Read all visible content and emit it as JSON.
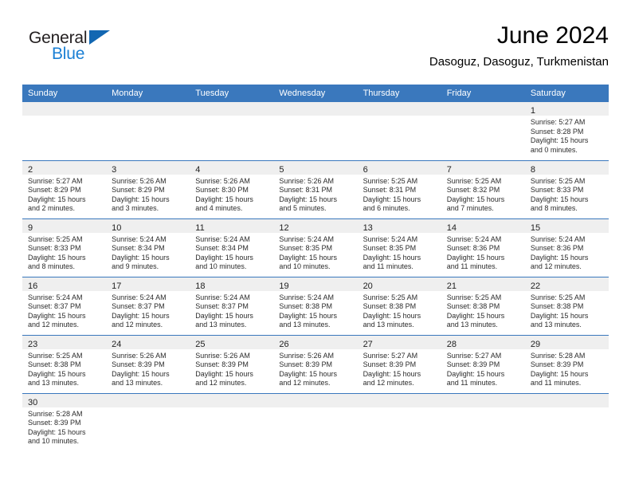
{
  "brand": {
    "word_one": "General",
    "word_two": "Blue",
    "triangle_color": "#1267b2",
    "blue_text_color": "#1a7fd4",
    "dark_text_color": "#231f20"
  },
  "header": {
    "month_title": "June 2024",
    "location": "Dasoguz, Dasoguz, Turkmenistan"
  },
  "theme": {
    "header_row_bg": "#3a78bd",
    "day_band_bg": "#efefef",
    "row_divider": "#3a78bd",
    "text": "#2b2b2b"
  },
  "weekday_headers": [
    "Sunday",
    "Monday",
    "Tuesday",
    "Wednesday",
    "Thursday",
    "Friday",
    "Saturday"
  ],
  "weeks": [
    [
      {
        "day": "",
        "sunrise": "",
        "sunset": "",
        "daylight_line1": "",
        "daylight_line2": "",
        "empty": true
      },
      {
        "day": "",
        "sunrise": "",
        "sunset": "",
        "daylight_line1": "",
        "daylight_line2": "",
        "empty": true
      },
      {
        "day": "",
        "sunrise": "",
        "sunset": "",
        "daylight_line1": "",
        "daylight_line2": "",
        "empty": true
      },
      {
        "day": "",
        "sunrise": "",
        "sunset": "",
        "daylight_line1": "",
        "daylight_line2": "",
        "empty": true
      },
      {
        "day": "",
        "sunrise": "",
        "sunset": "",
        "daylight_line1": "",
        "daylight_line2": "",
        "empty": true
      },
      {
        "day": "",
        "sunrise": "",
        "sunset": "",
        "daylight_line1": "",
        "daylight_line2": "",
        "empty": true
      },
      {
        "day": "1",
        "sunrise": "Sunrise: 5:27 AM",
        "sunset": "Sunset: 8:28 PM",
        "daylight_line1": "Daylight: 15 hours",
        "daylight_line2": "and 0 minutes.",
        "empty": false
      }
    ],
    [
      {
        "day": "2",
        "sunrise": "Sunrise: 5:27 AM",
        "sunset": "Sunset: 8:29 PM",
        "daylight_line1": "Daylight: 15 hours",
        "daylight_line2": "and 2 minutes.",
        "empty": false
      },
      {
        "day": "3",
        "sunrise": "Sunrise: 5:26 AM",
        "sunset": "Sunset: 8:29 PM",
        "daylight_line1": "Daylight: 15 hours",
        "daylight_line2": "and 3 minutes.",
        "empty": false
      },
      {
        "day": "4",
        "sunrise": "Sunrise: 5:26 AM",
        "sunset": "Sunset: 8:30 PM",
        "daylight_line1": "Daylight: 15 hours",
        "daylight_line2": "and 4 minutes.",
        "empty": false
      },
      {
        "day": "5",
        "sunrise": "Sunrise: 5:26 AM",
        "sunset": "Sunset: 8:31 PM",
        "daylight_line1": "Daylight: 15 hours",
        "daylight_line2": "and 5 minutes.",
        "empty": false
      },
      {
        "day": "6",
        "sunrise": "Sunrise: 5:25 AM",
        "sunset": "Sunset: 8:31 PM",
        "daylight_line1": "Daylight: 15 hours",
        "daylight_line2": "and 6 minutes.",
        "empty": false
      },
      {
        "day": "7",
        "sunrise": "Sunrise: 5:25 AM",
        "sunset": "Sunset: 8:32 PM",
        "daylight_line1": "Daylight: 15 hours",
        "daylight_line2": "and 7 minutes.",
        "empty": false
      },
      {
        "day": "8",
        "sunrise": "Sunrise: 5:25 AM",
        "sunset": "Sunset: 8:33 PM",
        "daylight_line1": "Daylight: 15 hours",
        "daylight_line2": "and 8 minutes.",
        "empty": false
      }
    ],
    [
      {
        "day": "9",
        "sunrise": "Sunrise: 5:25 AM",
        "sunset": "Sunset: 8:33 PM",
        "daylight_line1": "Daylight: 15 hours",
        "daylight_line2": "and 8 minutes.",
        "empty": false
      },
      {
        "day": "10",
        "sunrise": "Sunrise: 5:24 AM",
        "sunset": "Sunset: 8:34 PM",
        "daylight_line1": "Daylight: 15 hours",
        "daylight_line2": "and 9 minutes.",
        "empty": false
      },
      {
        "day": "11",
        "sunrise": "Sunrise: 5:24 AM",
        "sunset": "Sunset: 8:34 PM",
        "daylight_line1": "Daylight: 15 hours",
        "daylight_line2": "and 10 minutes.",
        "empty": false
      },
      {
        "day": "12",
        "sunrise": "Sunrise: 5:24 AM",
        "sunset": "Sunset: 8:35 PM",
        "daylight_line1": "Daylight: 15 hours",
        "daylight_line2": "and 10 minutes.",
        "empty": false
      },
      {
        "day": "13",
        "sunrise": "Sunrise: 5:24 AM",
        "sunset": "Sunset: 8:35 PM",
        "daylight_line1": "Daylight: 15 hours",
        "daylight_line2": "and 11 minutes.",
        "empty": false
      },
      {
        "day": "14",
        "sunrise": "Sunrise: 5:24 AM",
        "sunset": "Sunset: 8:36 PM",
        "daylight_line1": "Daylight: 15 hours",
        "daylight_line2": "and 11 minutes.",
        "empty": false
      },
      {
        "day": "15",
        "sunrise": "Sunrise: 5:24 AM",
        "sunset": "Sunset: 8:36 PM",
        "daylight_line1": "Daylight: 15 hours",
        "daylight_line2": "and 12 minutes.",
        "empty": false
      }
    ],
    [
      {
        "day": "16",
        "sunrise": "Sunrise: 5:24 AM",
        "sunset": "Sunset: 8:37 PM",
        "daylight_line1": "Daylight: 15 hours",
        "daylight_line2": "and 12 minutes.",
        "empty": false
      },
      {
        "day": "17",
        "sunrise": "Sunrise: 5:24 AM",
        "sunset": "Sunset: 8:37 PM",
        "daylight_line1": "Daylight: 15 hours",
        "daylight_line2": "and 12 minutes.",
        "empty": false
      },
      {
        "day": "18",
        "sunrise": "Sunrise: 5:24 AM",
        "sunset": "Sunset: 8:37 PM",
        "daylight_line1": "Daylight: 15 hours",
        "daylight_line2": "and 13 minutes.",
        "empty": false
      },
      {
        "day": "19",
        "sunrise": "Sunrise: 5:24 AM",
        "sunset": "Sunset: 8:38 PM",
        "daylight_line1": "Daylight: 15 hours",
        "daylight_line2": "and 13 minutes.",
        "empty": false
      },
      {
        "day": "20",
        "sunrise": "Sunrise: 5:25 AM",
        "sunset": "Sunset: 8:38 PM",
        "daylight_line1": "Daylight: 15 hours",
        "daylight_line2": "and 13 minutes.",
        "empty": false
      },
      {
        "day": "21",
        "sunrise": "Sunrise: 5:25 AM",
        "sunset": "Sunset: 8:38 PM",
        "daylight_line1": "Daylight: 15 hours",
        "daylight_line2": "and 13 minutes.",
        "empty": false
      },
      {
        "day": "22",
        "sunrise": "Sunrise: 5:25 AM",
        "sunset": "Sunset: 8:38 PM",
        "daylight_line1": "Daylight: 15 hours",
        "daylight_line2": "and 13 minutes.",
        "empty": false
      }
    ],
    [
      {
        "day": "23",
        "sunrise": "Sunrise: 5:25 AM",
        "sunset": "Sunset: 8:38 PM",
        "daylight_line1": "Daylight: 15 hours",
        "daylight_line2": "and 13 minutes.",
        "empty": false
      },
      {
        "day": "24",
        "sunrise": "Sunrise: 5:26 AM",
        "sunset": "Sunset: 8:39 PM",
        "daylight_line1": "Daylight: 15 hours",
        "daylight_line2": "and 13 minutes.",
        "empty": false
      },
      {
        "day": "25",
        "sunrise": "Sunrise: 5:26 AM",
        "sunset": "Sunset: 8:39 PM",
        "daylight_line1": "Daylight: 15 hours",
        "daylight_line2": "and 12 minutes.",
        "empty": false
      },
      {
        "day": "26",
        "sunrise": "Sunrise: 5:26 AM",
        "sunset": "Sunset: 8:39 PM",
        "daylight_line1": "Daylight: 15 hours",
        "daylight_line2": "and 12 minutes.",
        "empty": false
      },
      {
        "day": "27",
        "sunrise": "Sunrise: 5:27 AM",
        "sunset": "Sunset: 8:39 PM",
        "daylight_line1": "Daylight: 15 hours",
        "daylight_line2": "and 12 minutes.",
        "empty": false
      },
      {
        "day": "28",
        "sunrise": "Sunrise: 5:27 AM",
        "sunset": "Sunset: 8:39 PM",
        "daylight_line1": "Daylight: 15 hours",
        "daylight_line2": "and 11 minutes.",
        "empty": false
      },
      {
        "day": "29",
        "sunrise": "Sunrise: 5:28 AM",
        "sunset": "Sunset: 8:39 PM",
        "daylight_line1": "Daylight: 15 hours",
        "daylight_line2": "and 11 minutes.",
        "empty": false
      }
    ],
    [
      {
        "day": "30",
        "sunrise": "Sunrise: 5:28 AM",
        "sunset": "Sunset: 8:39 PM",
        "daylight_line1": "Daylight: 15 hours",
        "daylight_line2": "and 10 minutes.",
        "empty": false
      },
      {
        "day": "",
        "sunrise": "",
        "sunset": "",
        "daylight_line1": "",
        "daylight_line2": "",
        "empty": true
      },
      {
        "day": "",
        "sunrise": "",
        "sunset": "",
        "daylight_line1": "",
        "daylight_line2": "",
        "empty": true
      },
      {
        "day": "",
        "sunrise": "",
        "sunset": "",
        "daylight_line1": "",
        "daylight_line2": "",
        "empty": true
      },
      {
        "day": "",
        "sunrise": "",
        "sunset": "",
        "daylight_line1": "",
        "daylight_line2": "",
        "empty": true
      },
      {
        "day": "",
        "sunrise": "",
        "sunset": "",
        "daylight_line1": "",
        "daylight_line2": "",
        "empty": true
      },
      {
        "day": "",
        "sunrise": "",
        "sunset": "",
        "daylight_line1": "",
        "daylight_line2": "",
        "empty": true
      }
    ]
  ]
}
